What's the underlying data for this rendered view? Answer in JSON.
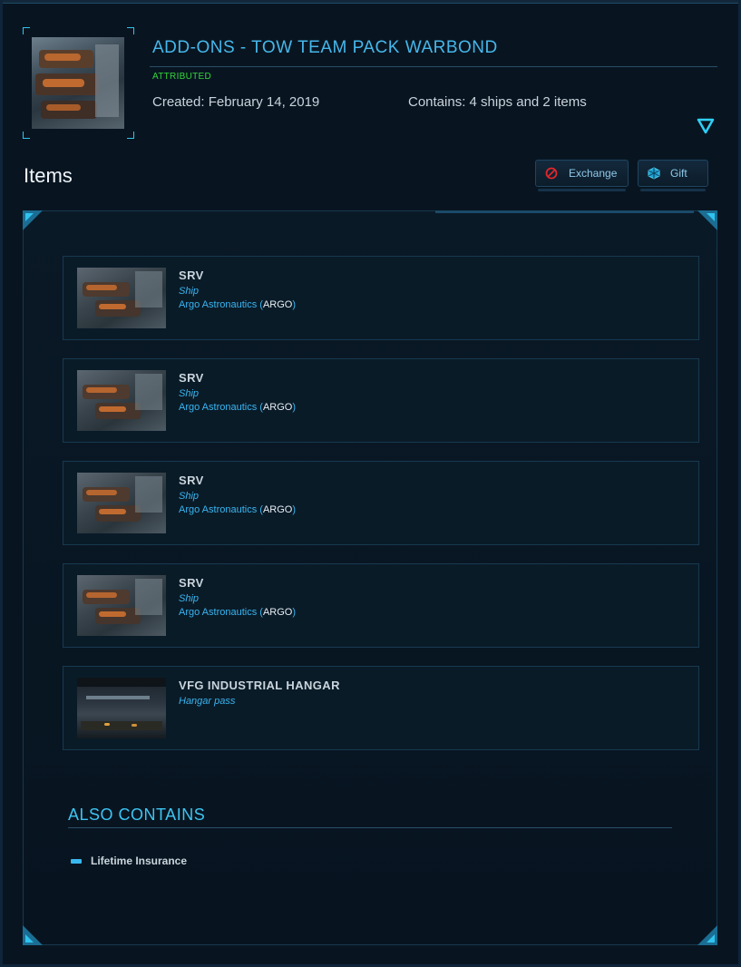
{
  "package": {
    "title": "ADD-ONS - TOW TEAM PACK WARBOND",
    "status": "ATTRIBUTED",
    "created": "Created: February 14, 2019",
    "contains": "Contains: 4 ships and 2 items"
  },
  "items_section": {
    "heading": "Items",
    "exchange_label": "Exchange",
    "gift_label": "Gift"
  },
  "items": [
    {
      "name": "SRV",
      "kind": "Ship",
      "maker": "Argo Astronautics (",
      "maker_code": "ARGO",
      "maker_close": ")"
    },
    {
      "name": "SRV",
      "kind": "Ship",
      "maker": "Argo Astronautics (",
      "maker_code": "ARGO",
      "maker_close": ")"
    },
    {
      "name": "SRV",
      "kind": "Ship",
      "maker": "Argo Astronautics (",
      "maker_code": "ARGO",
      "maker_close": ")"
    },
    {
      "name": "SRV",
      "kind": "Ship",
      "maker": "Argo Astronautics (",
      "maker_code": "ARGO",
      "maker_close": ")"
    },
    {
      "name": "VFG INDUSTRIAL HANGAR",
      "kind": "Hangar pass"
    }
  ],
  "also_contains": {
    "title": "ALSO CONTAINS",
    "items": [
      "Lifetime Insurance"
    ]
  },
  "colors": {
    "accent": "#2fc3ee",
    "status_green": "#35d43a",
    "background": "#081521"
  },
  "icons": {
    "toggle": "triangle-down-icon",
    "exchange": "no-entry-icon",
    "gift": "gift-cube-icon"
  }
}
